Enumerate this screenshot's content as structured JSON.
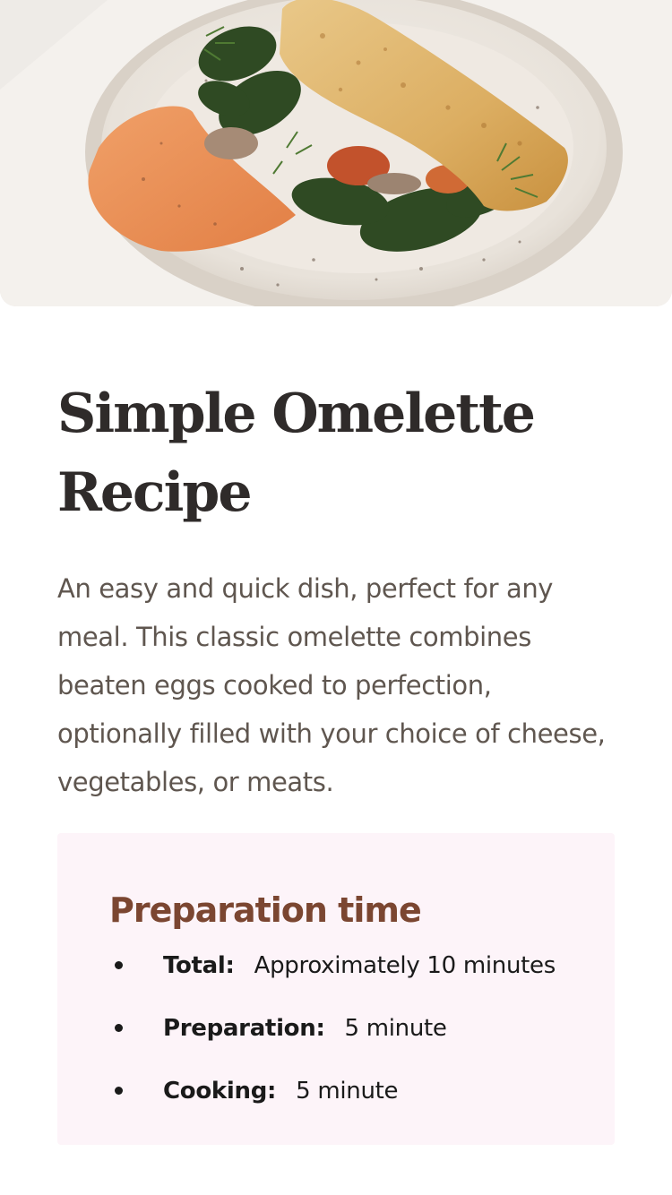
{
  "hero": {
    "image_alt": "omelette-with-spinach-and-red-pepper-spread"
  },
  "recipe": {
    "title": "Simple Omelette Recipe",
    "description": "An easy and quick dish, perfect for any meal. This classic omelette combines beaten eggs cooked to perfection, optionally filled with your choice of cheese, vegetables, or meats."
  },
  "preparation": {
    "heading": "Preparation time",
    "items": [
      {
        "label": "Total:",
        "value": "Approximately 10 minutes"
      },
      {
        "label": "Preparation:",
        "value": "5 minute"
      },
      {
        "label": "Cooking:",
        "value": "5 minute"
      }
    ]
  },
  "colors": {
    "heading_dark": "#2f2b2a",
    "body_text": "#5f564f",
    "accent_brown": "#7b4631",
    "panel_pink": "#fdf4f9"
  }
}
